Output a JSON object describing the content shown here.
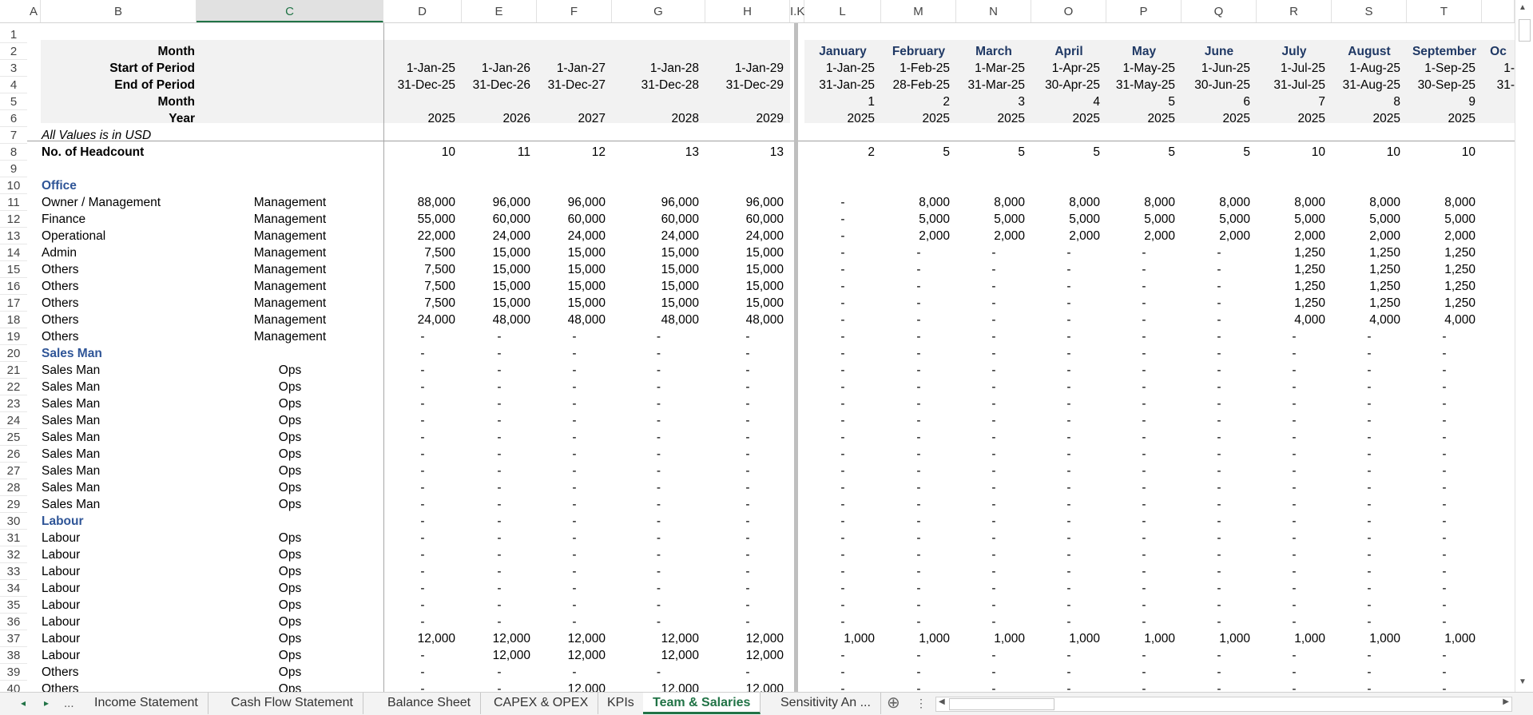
{
  "columns": [
    {
      "id": "A",
      "label": "A"
    },
    {
      "id": "B",
      "label": "B"
    },
    {
      "id": "C",
      "label": "C",
      "selected": true
    },
    {
      "id": "D",
      "label": "D"
    },
    {
      "id": "E",
      "label": "E"
    },
    {
      "id": "F",
      "label": "F"
    },
    {
      "id": "G",
      "label": "G"
    },
    {
      "id": "H",
      "label": "H"
    },
    {
      "id": "IJK",
      "label": "I.K"
    },
    {
      "id": "L",
      "label": "L"
    },
    {
      "id": "M",
      "label": "M"
    },
    {
      "id": "N",
      "label": "N"
    },
    {
      "id": "O",
      "label": "O"
    },
    {
      "id": "P",
      "label": "P"
    },
    {
      "id": "Q",
      "label": "Q"
    },
    {
      "id": "R",
      "label": "R"
    },
    {
      "id": "S",
      "label": "S"
    },
    {
      "id": "T",
      "label": "T"
    },
    {
      "id": "U",
      "label": ""
    }
  ],
  "rows": [
    {
      "n": "1",
      "cells": {}
    },
    {
      "n": "2",
      "cells": {
        "B": "Month",
        "L": "January",
        "M": "February",
        "N": "March",
        "O": "April",
        "P": "May",
        "Q": "June",
        "R": "July",
        "S": "August",
        "T": "September",
        "U": "Oc"
      }
    },
    {
      "n": "3",
      "cells": {
        "B": "Start of Period",
        "D": "1-Jan-25",
        "E": "1-Jan-26",
        "F": "1-Jan-27",
        "G": "1-Jan-28",
        "H": "1-Jan-29",
        "L": "1-Jan-25",
        "M": "1-Feb-25",
        "N": "1-Mar-25",
        "O": "1-Apr-25",
        "P": "1-May-25",
        "Q": "1-Jun-25",
        "R": "1-Jul-25",
        "S": "1-Aug-25",
        "T": "1-Sep-25",
        "U": "1-"
      }
    },
    {
      "n": "4",
      "cells": {
        "B": "End of Period",
        "D": "31-Dec-25",
        "E": "31-Dec-26",
        "F": "31-Dec-27",
        "G": "31-Dec-28",
        "H": "31-Dec-29",
        "L": "31-Jan-25",
        "M": "28-Feb-25",
        "N": "31-Mar-25",
        "O": "30-Apr-25",
        "P": "31-May-25",
        "Q": "30-Jun-25",
        "R": "31-Jul-25",
        "S": "31-Aug-25",
        "T": "30-Sep-25",
        "U": "31-"
      }
    },
    {
      "n": "5",
      "cells": {
        "B": "Month",
        "L": "1",
        "M": "2",
        "N": "3",
        "O": "4",
        "P": "5",
        "Q": "6",
        "R": "7",
        "S": "8",
        "T": "9"
      }
    },
    {
      "n": "6",
      "cells": {
        "B": "Year",
        "D": "2025",
        "E": "2026",
        "F": "2027",
        "G": "2028",
        "H": "2029",
        "L": "2025",
        "M": "2025",
        "N": "2025",
        "O": "2025",
        "P": "2025",
        "Q": "2025",
        "R": "2025",
        "S": "2025",
        "T": "2025"
      }
    },
    {
      "n": "7",
      "cells": {
        "B": "All Values is in USD"
      }
    },
    {
      "n": "8",
      "cells": {
        "B": "No. of Headcount",
        "D": "10",
        "E": "11",
        "F": "12",
        "G": "13",
        "H": "13",
        "L": "2",
        "M": "5",
        "N": "5",
        "O": "5",
        "P": "5",
        "Q": "5",
        "R": "10",
        "S": "10",
        "T": "10"
      }
    },
    {
      "n": "9",
      "cells": {}
    },
    {
      "n": "10",
      "cells": {
        "B": "Office"
      }
    },
    {
      "n": "11",
      "cells": {
        "B": "Owner / Management",
        "C": "Management",
        "D": "88,000",
        "E": "96,000",
        "F": "96,000",
        "G": "96,000",
        "H": "96,000",
        "L": "-",
        "M": "8,000",
        "N": "8,000",
        "O": "8,000",
        "P": "8,000",
        "Q": "8,000",
        "R": "8,000",
        "S": "8,000",
        "T": "8,000"
      }
    },
    {
      "n": "12",
      "cells": {
        "B": "Finance",
        "C": "Management",
        "D": "55,000",
        "E": "60,000",
        "F": "60,000",
        "G": "60,000",
        "H": "60,000",
        "L": "-",
        "M": "5,000",
        "N": "5,000",
        "O": "5,000",
        "P": "5,000",
        "Q": "5,000",
        "R": "5,000",
        "S": "5,000",
        "T": "5,000"
      }
    },
    {
      "n": "13",
      "cells": {
        "B": "Operational",
        "C": "Management",
        "D": "22,000",
        "E": "24,000",
        "F": "24,000",
        "G": "24,000",
        "H": "24,000",
        "L": "-",
        "M": "2,000",
        "N": "2,000",
        "O": "2,000",
        "P": "2,000",
        "Q": "2,000",
        "R": "2,000",
        "S": "2,000",
        "T": "2,000"
      }
    },
    {
      "n": "14",
      "cells": {
        "B": "Admin",
        "C": "Management",
        "D": "7,500",
        "E": "15,000",
        "F": "15,000",
        "G": "15,000",
        "H": "15,000",
        "L": "-",
        "M": "-",
        "N": "-",
        "O": "-",
        "P": "-",
        "Q": "-",
        "R": "1,250",
        "S": "1,250",
        "T": "1,250"
      }
    },
    {
      "n": "15",
      "cells": {
        "B": "Others",
        "C": "Management",
        "D": "7,500",
        "E": "15,000",
        "F": "15,000",
        "G": "15,000",
        "H": "15,000",
        "L": "-",
        "M": "-",
        "N": "-",
        "O": "-",
        "P": "-",
        "Q": "-",
        "R": "1,250",
        "S": "1,250",
        "T": "1,250"
      }
    },
    {
      "n": "16",
      "cells": {
        "B": "Others",
        "C": "Management",
        "D": "7,500",
        "E": "15,000",
        "F": "15,000",
        "G": "15,000",
        "H": "15,000",
        "L": "-",
        "M": "-",
        "N": "-",
        "O": "-",
        "P": "-",
        "Q": "-",
        "R": "1,250",
        "S": "1,250",
        "T": "1,250"
      }
    },
    {
      "n": "17",
      "cells": {
        "B": "Others",
        "C": "Management",
        "D": "7,500",
        "E": "15,000",
        "F": "15,000",
        "G": "15,000",
        "H": "15,000",
        "L": "-",
        "M": "-",
        "N": "-",
        "O": "-",
        "P": "-",
        "Q": "-",
        "R": "1,250",
        "S": "1,250",
        "T": "1,250"
      }
    },
    {
      "n": "18",
      "cells": {
        "B": "Others",
        "C": "Management",
        "D": "24,000",
        "E": "48,000",
        "F": "48,000",
        "G": "48,000",
        "H": "48,000",
        "L": "-",
        "M": "-",
        "N": "-",
        "O": "-",
        "P": "-",
        "Q": "-",
        "R": "4,000",
        "S": "4,000",
        "T": "4,000"
      }
    },
    {
      "n": "19",
      "cells": {
        "B": "Others",
        "C": "Management",
        "D": "-",
        "E": "-",
        "F": "-",
        "G": "-",
        "H": "-",
        "L": "-",
        "M": "-",
        "N": "-",
        "O": "-",
        "P": "-",
        "Q": "-",
        "R": "-",
        "S": "-",
        "T": "-"
      }
    },
    {
      "n": "20",
      "cells": {
        "B": "Sales Man",
        "D": "-",
        "E": "-",
        "F": "-",
        "G": "-",
        "H": "-",
        "L": "-",
        "M": "-",
        "N": "-",
        "O": "-",
        "P": "-",
        "Q": "-",
        "R": "-",
        "S": "-",
        "T": "-"
      }
    },
    {
      "n": "21",
      "cells": {
        "B": "Sales Man",
        "C": "Ops",
        "D": "-",
        "E": "-",
        "F": "-",
        "G": "-",
        "H": "-",
        "L": "-",
        "M": "-",
        "N": "-",
        "O": "-",
        "P": "-",
        "Q": "-",
        "R": "-",
        "S": "-",
        "T": "-"
      }
    },
    {
      "n": "22",
      "cells": {
        "B": "Sales Man",
        "C": "Ops",
        "D": "-",
        "E": "-",
        "F": "-",
        "G": "-",
        "H": "-",
        "L": "-",
        "M": "-",
        "N": "-",
        "O": "-",
        "P": "-",
        "Q": "-",
        "R": "-",
        "S": "-",
        "T": "-"
      }
    },
    {
      "n": "23",
      "cells": {
        "B": "Sales Man",
        "C": "Ops",
        "D": "-",
        "E": "-",
        "F": "-",
        "G": "-",
        "H": "-",
        "L": "-",
        "M": "-",
        "N": "-",
        "O": "-",
        "P": "-",
        "Q": "-",
        "R": "-",
        "S": "-",
        "T": "-"
      }
    },
    {
      "n": "24",
      "cells": {
        "B": "Sales Man",
        "C": "Ops",
        "D": "-",
        "E": "-",
        "F": "-",
        "G": "-",
        "H": "-",
        "L": "-",
        "M": "-",
        "N": "-",
        "O": "-",
        "P": "-",
        "Q": "-",
        "R": "-",
        "S": "-",
        "T": "-"
      }
    },
    {
      "n": "25",
      "cells": {
        "B": "Sales Man",
        "C": "Ops",
        "D": "-",
        "E": "-",
        "F": "-",
        "G": "-",
        "H": "-",
        "L": "-",
        "M": "-",
        "N": "-",
        "O": "-",
        "P": "-",
        "Q": "-",
        "R": "-",
        "S": "-",
        "T": "-"
      }
    },
    {
      "n": "26",
      "cells": {
        "B": "Sales Man",
        "C": "Ops",
        "D": "-",
        "E": "-",
        "F": "-",
        "G": "-",
        "H": "-",
        "L": "-",
        "M": "-",
        "N": "-",
        "O": "-",
        "P": "-",
        "Q": "-",
        "R": "-",
        "S": "-",
        "T": "-"
      }
    },
    {
      "n": "27",
      "cells": {
        "B": "Sales Man",
        "C": "Ops",
        "D": "-",
        "E": "-",
        "F": "-",
        "G": "-",
        "H": "-",
        "L": "-",
        "M": "-",
        "N": "-",
        "O": "-",
        "P": "-",
        "Q": "-",
        "R": "-",
        "S": "-",
        "T": "-"
      }
    },
    {
      "n": "28",
      "cells": {
        "B": "Sales Man",
        "C": "Ops",
        "D": "-",
        "E": "-",
        "F": "-",
        "G": "-",
        "H": "-",
        "L": "-",
        "M": "-",
        "N": "-",
        "O": "-",
        "P": "-",
        "Q": "-",
        "R": "-",
        "S": "-",
        "T": "-"
      }
    },
    {
      "n": "29",
      "cells": {
        "B": "Sales Man",
        "C": "Ops",
        "D": "-",
        "E": "-",
        "F": "-",
        "G": "-",
        "H": "-",
        "L": "-",
        "M": "-",
        "N": "-",
        "O": "-",
        "P": "-",
        "Q": "-",
        "R": "-",
        "S": "-",
        "T": "-"
      }
    },
    {
      "n": "30",
      "cells": {
        "B": "Labour",
        "D": "-",
        "E": "-",
        "F": "-",
        "G": "-",
        "H": "-",
        "L": "-",
        "M": "-",
        "N": "-",
        "O": "-",
        "P": "-",
        "Q": "-",
        "R": "-",
        "S": "-",
        "T": "-"
      }
    },
    {
      "n": "31",
      "cells": {
        "B": "Labour",
        "C": "Ops",
        "D": "-",
        "E": "-",
        "F": "-",
        "G": "-",
        "H": "-",
        "L": "-",
        "M": "-",
        "N": "-",
        "O": "-",
        "P": "-",
        "Q": "-",
        "R": "-",
        "S": "-",
        "T": "-"
      }
    },
    {
      "n": "32",
      "cells": {
        "B": "Labour",
        "C": "Ops",
        "D": "-",
        "E": "-",
        "F": "-",
        "G": "-",
        "H": "-",
        "L": "-",
        "M": "-",
        "N": "-",
        "O": "-",
        "P": "-",
        "Q": "-",
        "R": "-",
        "S": "-",
        "T": "-"
      }
    },
    {
      "n": "33",
      "cells": {
        "B": "Labour",
        "C": "Ops",
        "D": "-",
        "E": "-",
        "F": "-",
        "G": "-",
        "H": "-",
        "L": "-",
        "M": "-",
        "N": "-",
        "O": "-",
        "P": "-",
        "Q": "-",
        "R": "-",
        "S": "-",
        "T": "-"
      }
    },
    {
      "n": "34",
      "cells": {
        "B": "Labour",
        "C": "Ops",
        "D": "-",
        "E": "-",
        "F": "-",
        "G": "-",
        "H": "-",
        "L": "-",
        "M": "-",
        "N": "-",
        "O": "-",
        "P": "-",
        "Q": "-",
        "R": "-",
        "S": "-",
        "T": "-"
      }
    },
    {
      "n": "35",
      "cells": {
        "B": "Labour",
        "C": "Ops",
        "D": "-",
        "E": "-",
        "F": "-",
        "G": "-",
        "H": "-",
        "L": "-",
        "M": "-",
        "N": "-",
        "O": "-",
        "P": "-",
        "Q": "-",
        "R": "-",
        "S": "-",
        "T": "-"
      }
    },
    {
      "n": "36",
      "cells": {
        "B": "Labour",
        "C": "Ops",
        "D": "-",
        "E": "-",
        "F": "-",
        "G": "-",
        "H": "-",
        "L": "-",
        "M": "-",
        "N": "-",
        "O": "-",
        "P": "-",
        "Q": "-",
        "R": "-",
        "S": "-",
        "T": "-"
      }
    },
    {
      "n": "37",
      "cells": {
        "B": "Labour",
        "C": "Ops",
        "D": "12,000",
        "E": "12,000",
        "F": "12,000",
        "G": "12,000",
        "H": "12,000",
        "L": "1,000",
        "M": "1,000",
        "N": "1,000",
        "O": "1,000",
        "P": "1,000",
        "Q": "1,000",
        "R": "1,000",
        "S": "1,000",
        "T": "1,000"
      }
    },
    {
      "n": "38",
      "cells": {
        "B": "Labour",
        "C": "Ops",
        "D": "-",
        "E": "12,000",
        "F": "12,000",
        "G": "12,000",
        "H": "12,000",
        "L": "-",
        "M": "-",
        "N": "-",
        "O": "-",
        "P": "-",
        "Q": "-",
        "R": "-",
        "S": "-",
        "T": "-"
      }
    },
    {
      "n": "39",
      "cells": {
        "B": "Others",
        "C": "Ops",
        "D": "-",
        "E": "-",
        "F": "-",
        "G": "-",
        "H": "-",
        "L": "-",
        "M": "-",
        "N": "-",
        "O": "-",
        "P": "-",
        "Q": "-",
        "R": "-",
        "S": "-",
        "T": "-"
      }
    },
    {
      "n": "40",
      "cells": {
        "B": "Others",
        "C": "Ops",
        "D": "-",
        "E": "-",
        "F": "12,000",
        "G": "12,000",
        "H": "12,000",
        "L": "-",
        "M": "-",
        "N": "-",
        "O": "-",
        "P": "-",
        "Q": "-",
        "R": "-",
        "S": "-",
        "T": "-"
      }
    }
  ],
  "tabs": {
    "nav_prev": "◂",
    "nav_next": "▸",
    "nav_more": "...",
    "items": [
      {
        "label": "Income Statement"
      },
      {
        "label": "Cash Flow Statement"
      },
      {
        "label": "Balance Sheet"
      },
      {
        "label": "CAPEX & OPEX"
      },
      {
        "label": "KPIs"
      },
      {
        "label": "Team & Salaries",
        "active": true
      },
      {
        "label": "Sensitivity An ..."
      }
    ],
    "add_label": "⊕",
    "options_label": "⋮"
  },
  "colors": {
    "accent": "#217346",
    "header_text": "#1f3864",
    "section_text": "#2f5597",
    "shade": "#f2f2f2"
  }
}
